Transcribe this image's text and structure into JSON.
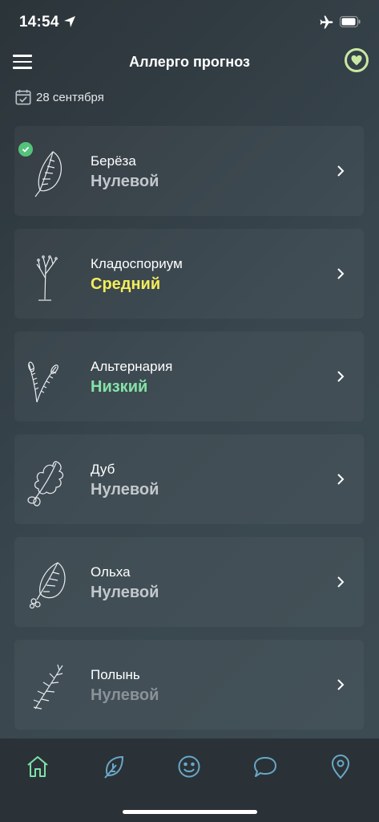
{
  "status": {
    "time": "14:54"
  },
  "header": {
    "title": "Аллерго прогноз"
  },
  "date": {
    "label": "28 сентября"
  },
  "allergens": [
    {
      "name": "Берёза",
      "level": "Нулевой",
      "level_color": "#c3c8cc",
      "icon": "birch-leaf-icon",
      "checked": true
    },
    {
      "name": "Кладоспориум",
      "level": "Средний",
      "level_color": "#f4ec5b",
      "icon": "cladosporium-icon",
      "checked": false
    },
    {
      "name": "Альтернария",
      "level": "Низкий",
      "level_color": "#84e3a6",
      "icon": "alternaria-icon",
      "checked": false
    },
    {
      "name": "Дуб",
      "level": "Нулевой",
      "level_color": "#c3c8cc",
      "icon": "oak-leaf-icon",
      "checked": false
    },
    {
      "name": "Ольха",
      "level": "Нулевой",
      "level_color": "#c3c8cc",
      "icon": "alder-leaf-icon",
      "checked": false
    },
    {
      "name": "Полынь",
      "level": "Нулевой",
      "level_color": "#8b9297",
      "icon": "wormwood-icon",
      "checked": false
    }
  ],
  "tabbar": {
    "active_color": "#7fe0a9",
    "inactive_color": "#6aa7c7",
    "tabs": [
      "home-icon",
      "leaf-icon",
      "smiley-icon",
      "chat-icon",
      "location-pin-icon"
    ]
  }
}
